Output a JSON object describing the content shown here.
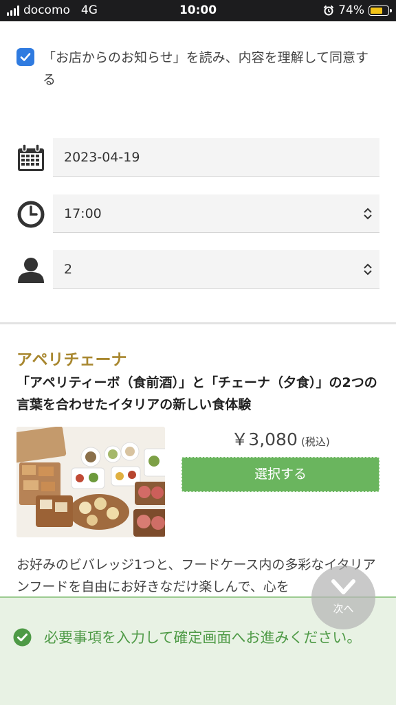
{
  "status_bar": {
    "carrier": "docomo",
    "network": "4G",
    "time": "10:00",
    "battery": "74%",
    "battery_level": 0.74,
    "battery_color": "#f2c318"
  },
  "agreement": {
    "checked": true,
    "text": "「お店からのお知らせ」を読み、内容を理解して同意する"
  },
  "form": {
    "date": {
      "icon": "calendar-icon",
      "value": "2023-04-19"
    },
    "time": {
      "icon": "clock-icon",
      "value": "17:00"
    },
    "people": {
      "icon": "person-icon",
      "value": "2"
    }
  },
  "plan": {
    "title": "アペリチェーナ",
    "subtitle": "「アペリティーボ（食前酒）」と「チェーナ（夕食）」の2つの言葉を合わせたイタリアの新しい食体験",
    "price": "￥3,080",
    "tax_note": "(税込)",
    "select_label": "選択する",
    "description": "お好みのビバレッジ1つと、フードケース内の多彩なイタリアンフードを自由にお好きなだけ楽しんで、心を"
  },
  "next_button": {
    "label": "次へ",
    "icon": "chevron-down-icon"
  },
  "notice": {
    "icon": "check-circle-icon",
    "text": "必要事項を入力して確定画面へお進みください。"
  },
  "colors": {
    "accent_blue": "#2f7be0",
    "plan_title": "#a8872f",
    "button_green": "#6ab55e",
    "notice_green": "#4e9a46"
  }
}
